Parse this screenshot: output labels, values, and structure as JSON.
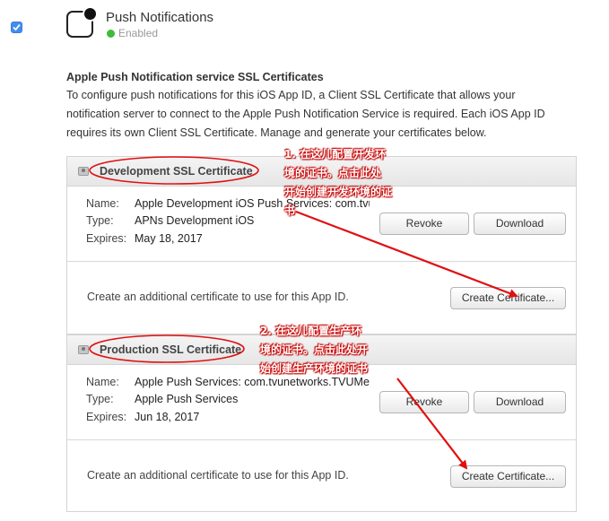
{
  "service": {
    "title": "Push Notifications",
    "status": "Enabled",
    "status_color": "#3dbb3d"
  },
  "section": {
    "title": "Apple Push Notification service SSL Certificates",
    "description": "To configure push notifications for this iOS App ID, a Client SSL Certificate that allows your notification server to connect to the Apple Push Notification Service is required. Each iOS App ID requires its own Client SSL Certificate. Manage and generate your certificates below."
  },
  "labels": {
    "name": "Name:",
    "type": "Type:",
    "expires": "Expires:"
  },
  "development": {
    "title": "Development SSL Certificate",
    "name": "Apple Development iOS Push Services: com.tvunet...",
    "type": "APNs Development iOS",
    "expires": "May 18, 2017",
    "revoke": "Revoke",
    "download": "Download",
    "add_text": "Create an additional certificate to use for this App ID.",
    "create": "Create Certificate..."
  },
  "production": {
    "title": "Production SSL Certificate",
    "name": "Apple Push Services: com.tvunetworks.TVUMe",
    "type": "Apple Push Services",
    "expires": "Jun 18, 2017",
    "revoke": "Revoke",
    "download": "Download",
    "add_text": "Create an additional certificate to use for this App ID.",
    "create": "Create Certificate..."
  },
  "annotations": {
    "dev": [
      "1. 在这儿配置开发环",
      "境的证书。点击此处",
      "开始创建开发环境的证",
      "书"
    ],
    "prod": [
      "2. 在这儿配置生产环",
      "境的证书。点击此处开",
      "始创建生产环境的证书"
    ],
    "color": "#e01010"
  }
}
